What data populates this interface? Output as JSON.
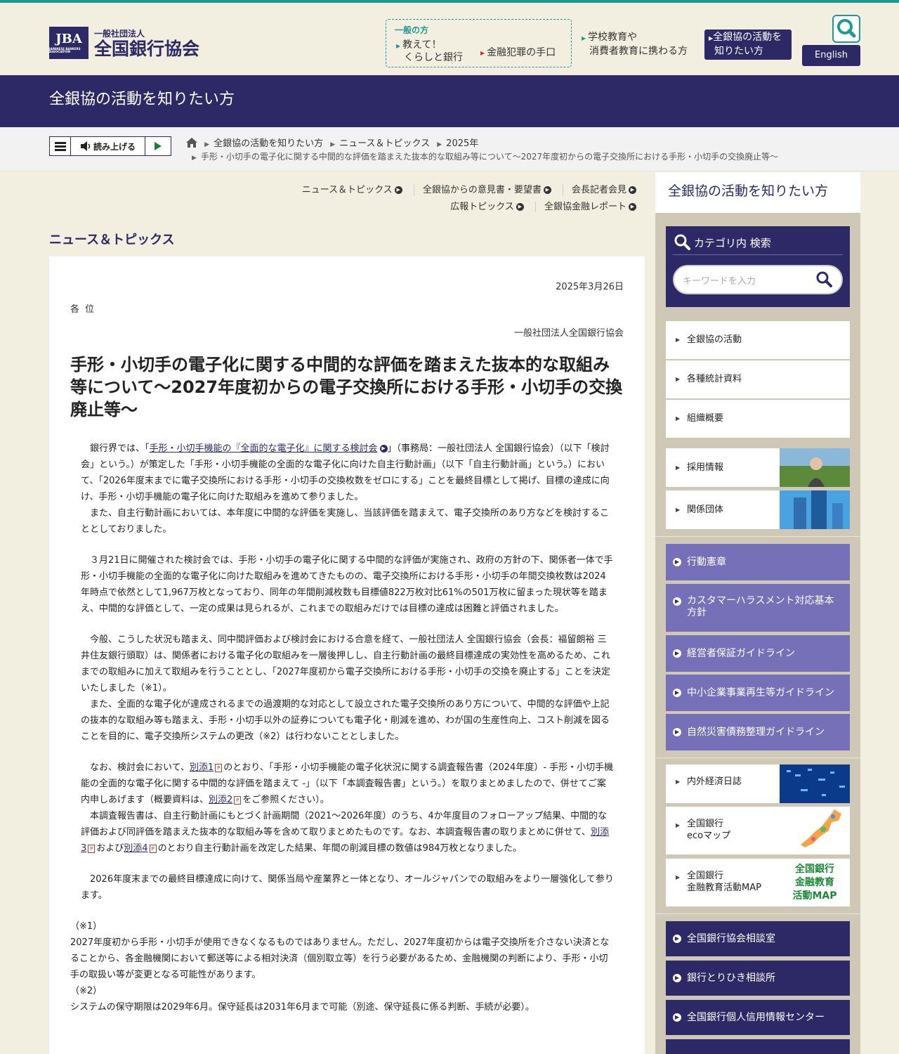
{
  "header": {
    "logo_abbr": "JBA",
    "logo_small": "JAPANESE BANKERS ASSOCIATION",
    "logo_sub": "一般社団法人",
    "logo_main": "全国銀行協会",
    "general_title": "一般の方",
    "general_link1_line1": "教えて！",
    "general_link1_line2": "くらしと銀行",
    "general_link2": "金融犯罪の手口",
    "school_line1": "学校教育や",
    "school_line2": "消費者教育に携わる方",
    "activity_line1": "全銀協の活動を",
    "activity_line2": "知りたい方",
    "english": "English"
  },
  "page_band_title": "全銀協の活動を知りたい方",
  "reader": {
    "read_label": "読み上げる"
  },
  "breadcrumb": {
    "items": [
      "全銀協の活動を知りたい方",
      "ニュース＆トピックス",
      "2025年"
    ],
    "current": "手形・小切手の電子化に関する中間的な評価を踏まえた抜本的な取組み等について〜2027年度初からの電子交換所における手形・小切手の交換廃止等〜"
  },
  "sub_links": {
    "row1": [
      "ニュース＆トピックス",
      "全銀協からの意見書・要望書",
      "会長記者会見"
    ],
    "row2": [
      "広報トピックス",
      "全銀協金融レポート"
    ]
  },
  "section_heading": "ニュース＆トピックス",
  "article": {
    "date": "2025年3月26日",
    "addressee": "各位",
    "issuer": "一般社団法人全国銀行協会",
    "title": "手形・小切手の電子化に関する中間的な評価を踏まえた抜本的な取組み等について〜2027年度初からの電子交換所における手形・小切手の交換廃止等〜",
    "p1_a": "　銀行界では、「",
    "p1_link": "手形・小切手機能の『全面的な電子化』に関する検討会",
    "p1_b": "」（事務局：一般社団法人 全国銀行協会）（以下「検討会」という。）が策定した「手形・小切手機能の全面的な電子化に向けた自主行動計画」（以下「自主行動計画」という。）において、「2026年度末までに電子交換所における手形・小切手の交換枚数をゼロにする」ことを最終目標として掲げ、目標の達成に向け、手形・小切手機能の電子化に向けた取組みを進めて参りました。",
    "p1_c": "　また、自主行動計画においては、本年度に中間的な評価を実施し、当該評価を踏まえて、電子交換所のあり方などを検討することとしておりました。",
    "p2": "　３月21日に開催された検討会では、手形・小切手の電子化に関する中間的な評価が実施され、政府の方針の下、関係者一体で手形・小切手機能の全面的な電子化に向けた取組みを進めてきたものの、電子交換所における手形・小切手の年間交換枚数は2024年時点で依然として1,967万枚となっており、同年の年間削減枚数も目標値822万枚対比61%の501万枚に留まった現状等を踏まえ、中間的な評価として、一定の成果は見られるが、これまでの取組みだけでは目標の達成は困難と評価されました。",
    "p3_a": "　今般、こうした状況も踏まえ、同中間評価および検討会における合意を経て、一般社団法人 全国銀行協会（会長：福留朗裕 三井住友銀行頭取）は、関係者における電子化の取組みを一層後押しし、自主行動計画の最終目標達成の実効性を高めるため、これまでの取組みに加えて取組みを行うこととし、「2027年度初から電子交換所における手形・小切手の交換を廃止する」ことを決定いたしました（※1）。",
    "p3_b": "　また、全面的な電子化が達成されるまでの過渡期的な対応として設立された電子交換所のあり方について、中間的な評価や上記の抜本的な取組み等も踏まえ、手形・小切手以外の証券についても電子化・削減を進め、わが国の生産性向上、コスト削減を図ることを目的に、電子交換所システムの更改（※2）は行わないこととしました。",
    "p4_a": "　なお、検討会において、",
    "p4_link1": "別添1",
    "p4_b": "のとおり、「手形・小切手機能の電子化状況に関する調査報告書（2024年度）- 手形・小切手機能の全面的な電子化に関する中間的な評価を踏まえて -」（以下「本調査報告書」という。）を取りまとめましたので、併せてご案内申しあげます（概要資料は、",
    "p4_link2": "別添2",
    "p4_c": "をご参照ください）。",
    "p4_d": "　本調査報告書は、自主行動計画にもとづく計画期間（2021〜2026年度）のうち、4か年度目のフォローアップ結果、中間的な評価および同評価を踏まえた抜本的な取組み等を含めて取りまとめたものです。なお、本調査報告書の取りまとめに併せて、",
    "p4_link3": "別添3",
    "p4_e": "および",
    "p4_link4": "別添4",
    "p4_f": "のとおり自主行動計画を改定した結果、年間の削減目標の数値は984万枚となりました。",
    "p5": "　2026年度末までの最終目標達成に向けて、関係当局や産業界と一体となり、オールジャパンでの取組みをより一層強化して参ります。",
    "note1_label": "（※1）",
    "note1": "2027年度初から手形・小切手が使用できなくなるものではありません。ただし、2027年度初からは電子交換所を介さない決済となることから、各金融機関において郵送等による相対決済（個別取立等）を行う必要があるため、金融機関の判断により、手形・小切手の取扱い等が変更となる可能性があります。",
    "note2_label": "（※2）",
    "note2": "システムの保守期限は2029年6月。保守延長は2031年6月まで可能（別途、保守延長に係る判断、手続が必要）。"
  },
  "sidebar": {
    "heading": "全銀協の活動を知りたい方",
    "search_title": "カテゴリ内 検索",
    "search_placeholder": "キーワードを入力",
    "links": [
      "全銀協の活動",
      "各種統計資料",
      "組織概要"
    ],
    "image_links": [
      "採用情報",
      "関係団体"
    ],
    "purple_links": [
      "行動憲章",
      "カスタマーハラスメント対応基本方針",
      "経営者保証ガイドライン",
      "中小企業事業再生等ガイドライン",
      "自然災害債務整理ガイドライン"
    ],
    "img_links2": {
      "diary": "内外経済日誌",
      "eco_line1": "全国銀行",
      "eco_line2": "ecoマップ",
      "edu_line1": "全国銀行",
      "edu_line2": "金融教育活動MAP",
      "edu_img_line1": "全国銀行",
      "edu_img_line2": "金融教育",
      "edu_img_line3": "活動MAP"
    },
    "dark_links": [
      "全国銀行協会相談室",
      "銀行とりひき相談所",
      "全国銀行個人信用情報センター"
    ]
  },
  "colors": {
    "navy": "#2c2966",
    "teal": "#1f9a93",
    "purple": "#7570b8",
    "beige": "#f3efe0"
  }
}
